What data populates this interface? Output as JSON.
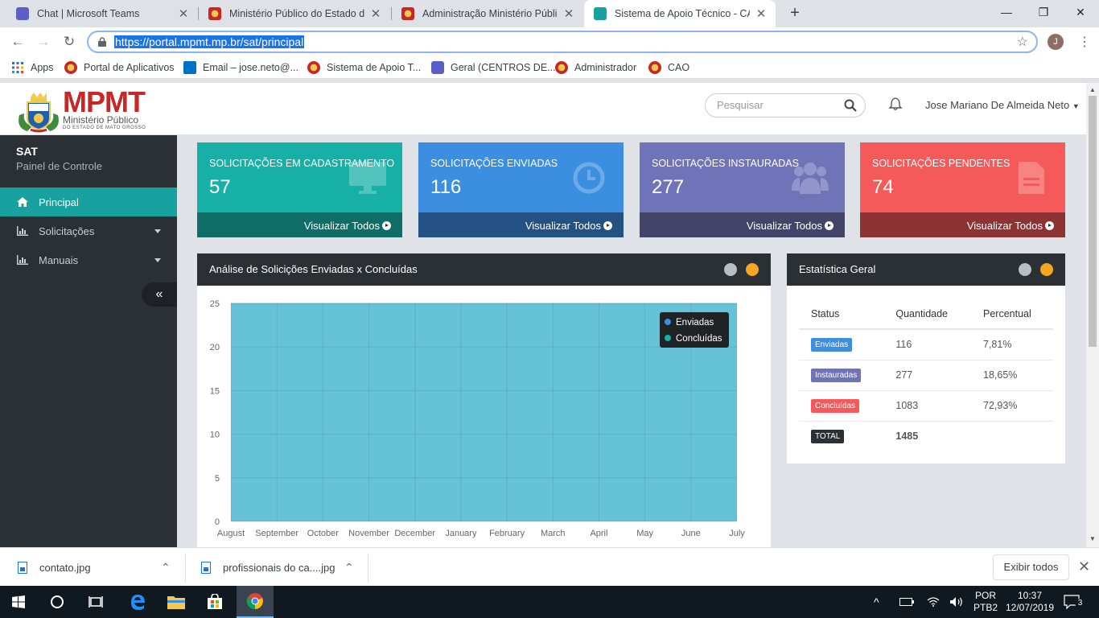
{
  "browser": {
    "tabs": [
      {
        "title": "Chat | Microsoft Teams",
        "icon": "teams-icon",
        "color": "#5b5fc7"
      },
      {
        "title": "Ministério Público do Estado de M",
        "icon": "mpmt-icon",
        "color": "#c62828"
      },
      {
        "title": "Administração Ministério Público",
        "icon": "mpmt-icon",
        "color": "#c62828"
      },
      {
        "title": "Sistema de Apoio Técnico - CAOP",
        "icon": "sat-icon",
        "color": "#17a2a0"
      }
    ],
    "url": "https://portal.mpmt.mp.br/sat/principal",
    "profile_initial": "J",
    "bookmarks": [
      {
        "label": "Apps",
        "icon": "apps-grid-icon"
      },
      {
        "label": "Portal de Aplicativos",
        "icon": "mpmt-icon"
      },
      {
        "label": "Email – jose.neto@...",
        "icon": "outlook-icon"
      },
      {
        "label": "Sistema de Apoio T...",
        "icon": "mpmt-icon"
      },
      {
        "label": "Geral (CENTROS DE...",
        "icon": "teams-icon"
      },
      {
        "label": "Administrador",
        "icon": "mpmt-icon"
      },
      {
        "label": "CAO",
        "icon": "mpmt-icon"
      }
    ]
  },
  "header": {
    "logo_title": "MPMT",
    "logo_subtitle": "Ministério Público",
    "logo_subtitle2": "DO ESTADO DE MATO GROSSO",
    "search_placeholder": "Pesquisar",
    "user_name": "Jose Mariano De Almeida Neto"
  },
  "sidebar": {
    "title": "SAT",
    "subtitle": "Painel de Controle",
    "items": [
      {
        "label": "Principal",
        "icon": "home-icon",
        "active": true
      },
      {
        "label": "Solicitações",
        "icon": "bar-chart-icon",
        "active": false
      },
      {
        "label": "Manuais",
        "icon": "bar-chart-icon",
        "active": false
      }
    ],
    "collapse_label": "«"
  },
  "cards": [
    {
      "title": "SOLICITAÇÕES EM CADASTRAMENTO",
      "value": "57",
      "footer": "Visualizar Todos",
      "color": "#17b0a7",
      "footer_color": "#0f6c66",
      "icon": "monitor-icon"
    },
    {
      "title": "SOLICITAÇÕES ENVIADAS",
      "value": "116",
      "footer": "Visualizar Todos",
      "color": "#3c8fe0",
      "footer_color": "#245184",
      "icon": "clock-icon"
    },
    {
      "title": "SOLICITAÇÕES INSTAURADAS",
      "value": "277",
      "footer": "Visualizar Todos",
      "color": "#6f73b8",
      "footer_color": "#424568",
      "icon": "users-icon"
    },
    {
      "title": "SOLICITAÇÕES PENDENTES",
      "value": "74",
      "footer": "Visualizar Todos",
      "color": "#f55a5a",
      "footer_color": "#8e3333",
      "icon": "document-icon"
    }
  ],
  "chart_panel": {
    "title": "Análise de Solicições Enviadas x Concluídas"
  },
  "chart_data": {
    "type": "area",
    "categories": [
      "August",
      "September",
      "October",
      "November",
      "December",
      "January",
      "February",
      "March",
      "April",
      "May",
      "June",
      "July"
    ],
    "series": [
      {
        "name": "Enviadas",
        "color": "#3c8fe0",
        "values": [
          25,
          25,
          25,
          25,
          25,
          25,
          25,
          25,
          25,
          25,
          25,
          25
        ]
      },
      {
        "name": "Concluídas",
        "color": "#17b0a7",
        "values": [
          25,
          25,
          25,
          25,
          25,
          25,
          25,
          25,
          25,
          25,
          25,
          25
        ]
      }
    ],
    "yticks": [
      "0",
      "5",
      "10",
      "15",
      "20",
      "25"
    ],
    "ylim": [
      0,
      25
    ],
    "grid": true,
    "fill_color": "#66c2d6",
    "legend_position": "top-right"
  },
  "stats_panel": {
    "title": "Estatística Geral",
    "headers": [
      "Status",
      "Quantidade",
      "Percentual"
    ],
    "rows": [
      {
        "status": "Enviadas",
        "quantity": "116",
        "percent": "7,81%",
        "color": "#3c8fe0"
      },
      {
        "status": "Instauradas",
        "quantity": "277",
        "percent": "18,65%",
        "color": "#6f73b8"
      },
      {
        "status": "Concluídas",
        "quantity": "1083",
        "percent": "72,93%",
        "color": "#f55a5a"
      },
      {
        "status": "TOTAL",
        "quantity": "1485",
        "percent": "",
        "color": "#2b3035"
      }
    ]
  },
  "downloads": [
    {
      "name": "contato.jpg"
    },
    {
      "name": "profissionais do ca....jpg"
    }
  ],
  "downloads_show_all": "Exibir todos",
  "taskbar": {
    "lang_top": "POR",
    "lang_bottom": "PTB2",
    "time": "10:37",
    "date": "12/07/2019",
    "notifications": "3"
  }
}
